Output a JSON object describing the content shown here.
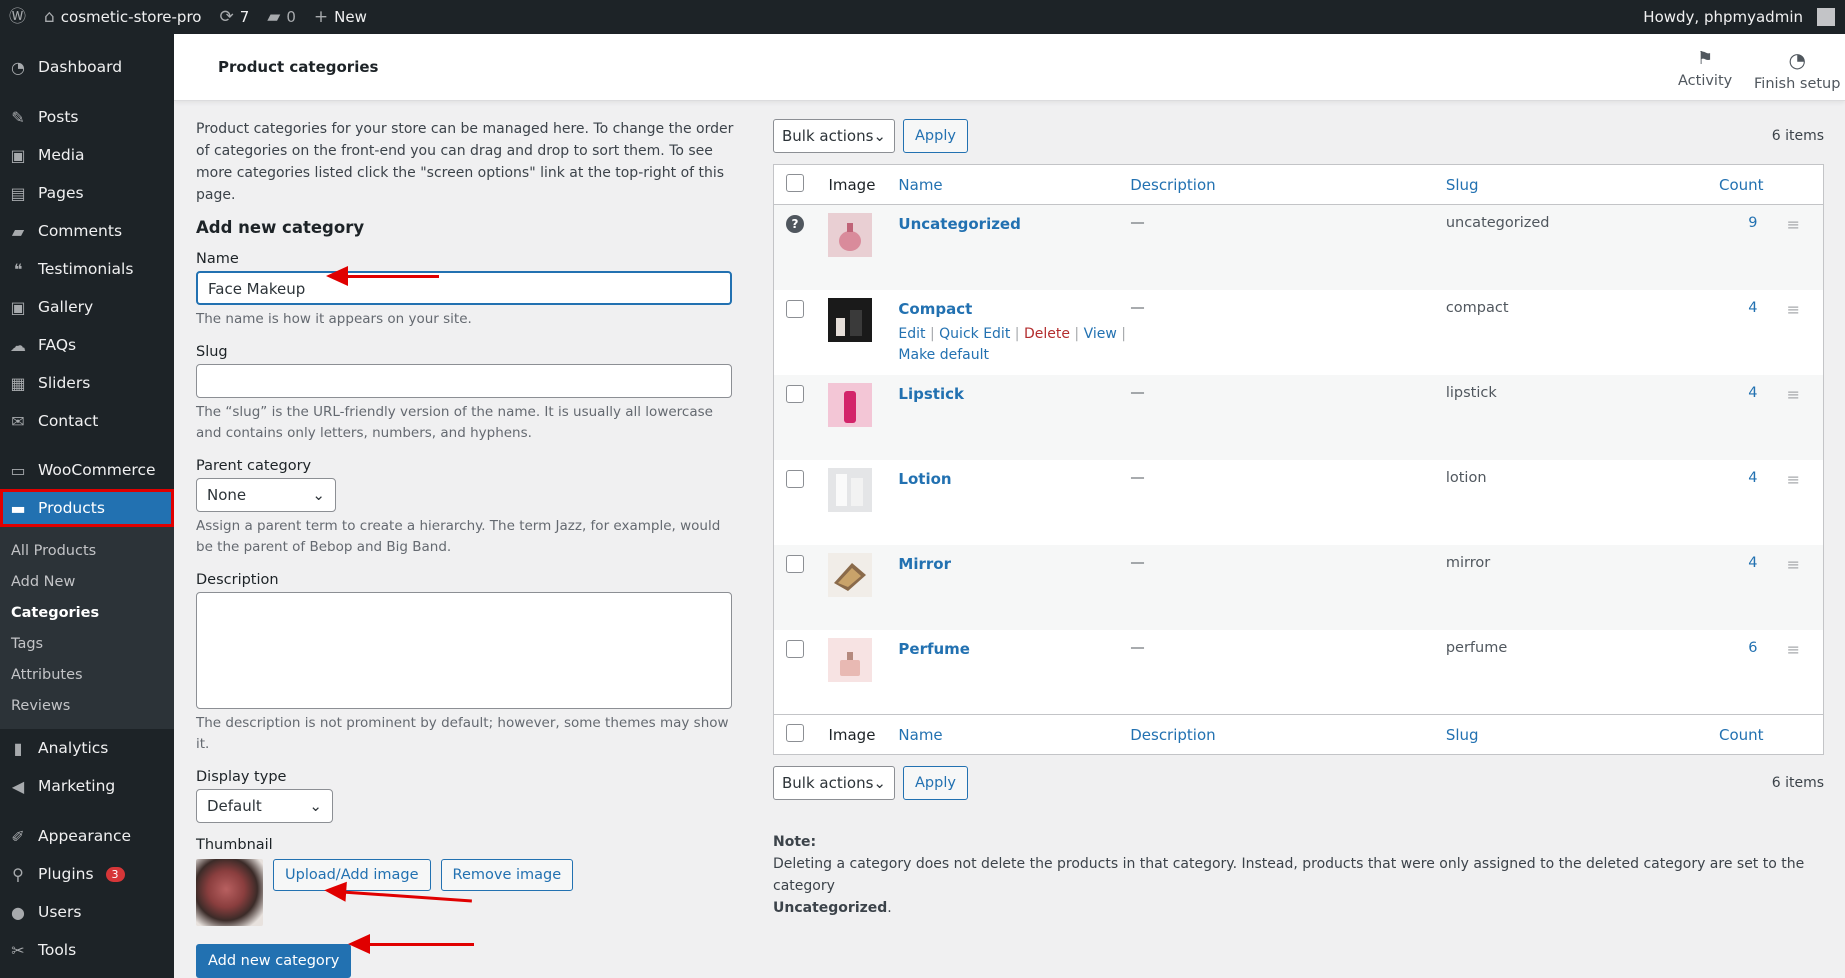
{
  "adminbar": {
    "site_name": "cosmetic-store-pro",
    "updates": "7",
    "comments": "0",
    "new_label": "New",
    "howdy": "Howdy, phpmyadmin"
  },
  "sidebar": {
    "items": [
      {
        "label": "Dashboard",
        "icon": "dashboard-icon"
      },
      {
        "label": "Posts",
        "icon": "pin-icon"
      },
      {
        "label": "Media",
        "icon": "media-icon"
      },
      {
        "label": "Pages",
        "icon": "pages-icon"
      },
      {
        "label": "Comments",
        "icon": "comment-icon"
      },
      {
        "label": "Testimonials",
        "icon": "testimonial-icon"
      },
      {
        "label": "Gallery",
        "icon": "gallery-icon"
      },
      {
        "label": "FAQs",
        "icon": "faq-icon"
      },
      {
        "label": "Sliders",
        "icon": "slider-icon"
      },
      {
        "label": "Contact",
        "icon": "mail-icon"
      },
      {
        "label": "WooCommerce",
        "icon": "woo-icon"
      },
      {
        "label": "Products",
        "icon": "archive-icon"
      },
      {
        "label": "Analytics",
        "icon": "chart-icon"
      },
      {
        "label": "Marketing",
        "icon": "megaphone-icon"
      },
      {
        "label": "Appearance",
        "icon": "brush-icon"
      },
      {
        "label": "Plugins",
        "icon": "plugin-icon",
        "badge": "3"
      },
      {
        "label": "Users",
        "icon": "user-icon"
      },
      {
        "label": "Tools",
        "icon": "wrench-icon"
      }
    ],
    "submenu": [
      "All Products",
      "Add New",
      "Categories",
      "Tags",
      "Attributes",
      "Reviews"
    ]
  },
  "header": {
    "title": "Product categories",
    "activity": "Activity",
    "finish_setup": "Finish setup"
  },
  "form": {
    "intro": "Product categories for your store can be managed here. To change the order of categories on the front-end you can drag and drop to sort them. To see more categories listed click the \"screen options\" link at the top-right of this page.",
    "heading": "Add new category",
    "name_label": "Name",
    "name_value": "Face Makeup",
    "name_help": "The name is how it appears on your site.",
    "slug_label": "Slug",
    "slug_value": "",
    "slug_help": "The “slug” is the URL-friendly version of the name. It is usually all lowercase and contains only letters, numbers, and hyphens.",
    "parent_label": "Parent category",
    "parent_value": "None",
    "parent_help": "Assign a parent term to create a hierarchy. The term Jazz, for example, would be the parent of Bebop and Big Band.",
    "desc_label": "Description",
    "desc_help": "The description is not prominent by default; however, some themes may show it.",
    "display_label": "Display type",
    "display_value": "Default",
    "thumb_label": "Thumbnail",
    "upload_btn": "Upload/Add image",
    "remove_btn": "Remove image",
    "submit": "Add new category"
  },
  "table": {
    "bulk": "Bulk actions",
    "apply": "Apply",
    "items": "6 items",
    "columns": {
      "image": "Image",
      "name": "Name",
      "description": "Description",
      "slug": "Slug",
      "count": "Count"
    },
    "row_actions": {
      "edit": "Edit",
      "quick_edit": "Quick Edit",
      "delete": "Delete",
      "view": "View",
      "make_default": "Make default"
    },
    "rows": [
      {
        "name": "Uncategorized",
        "description": "—",
        "slug": "uncategorized",
        "count": "9"
      },
      {
        "name": "Compact",
        "description": "—",
        "slug": "compact",
        "count": "4"
      },
      {
        "name": "Lipstick",
        "description": "—",
        "slug": "lipstick",
        "count": "4"
      },
      {
        "name": "Lotion",
        "description": "—",
        "slug": "lotion",
        "count": "4"
      },
      {
        "name": "Mirror",
        "description": "—",
        "slug": "mirror",
        "count": "4"
      },
      {
        "name": "Perfume",
        "description": "—",
        "slug": "perfume",
        "count": "6"
      }
    ],
    "note_label": "Note:",
    "note_text": "Deleting a category does not delete the products in that category. Instead, products that were only assigned to the deleted category are set to the category",
    "note_bold": "Uncategorized"
  }
}
